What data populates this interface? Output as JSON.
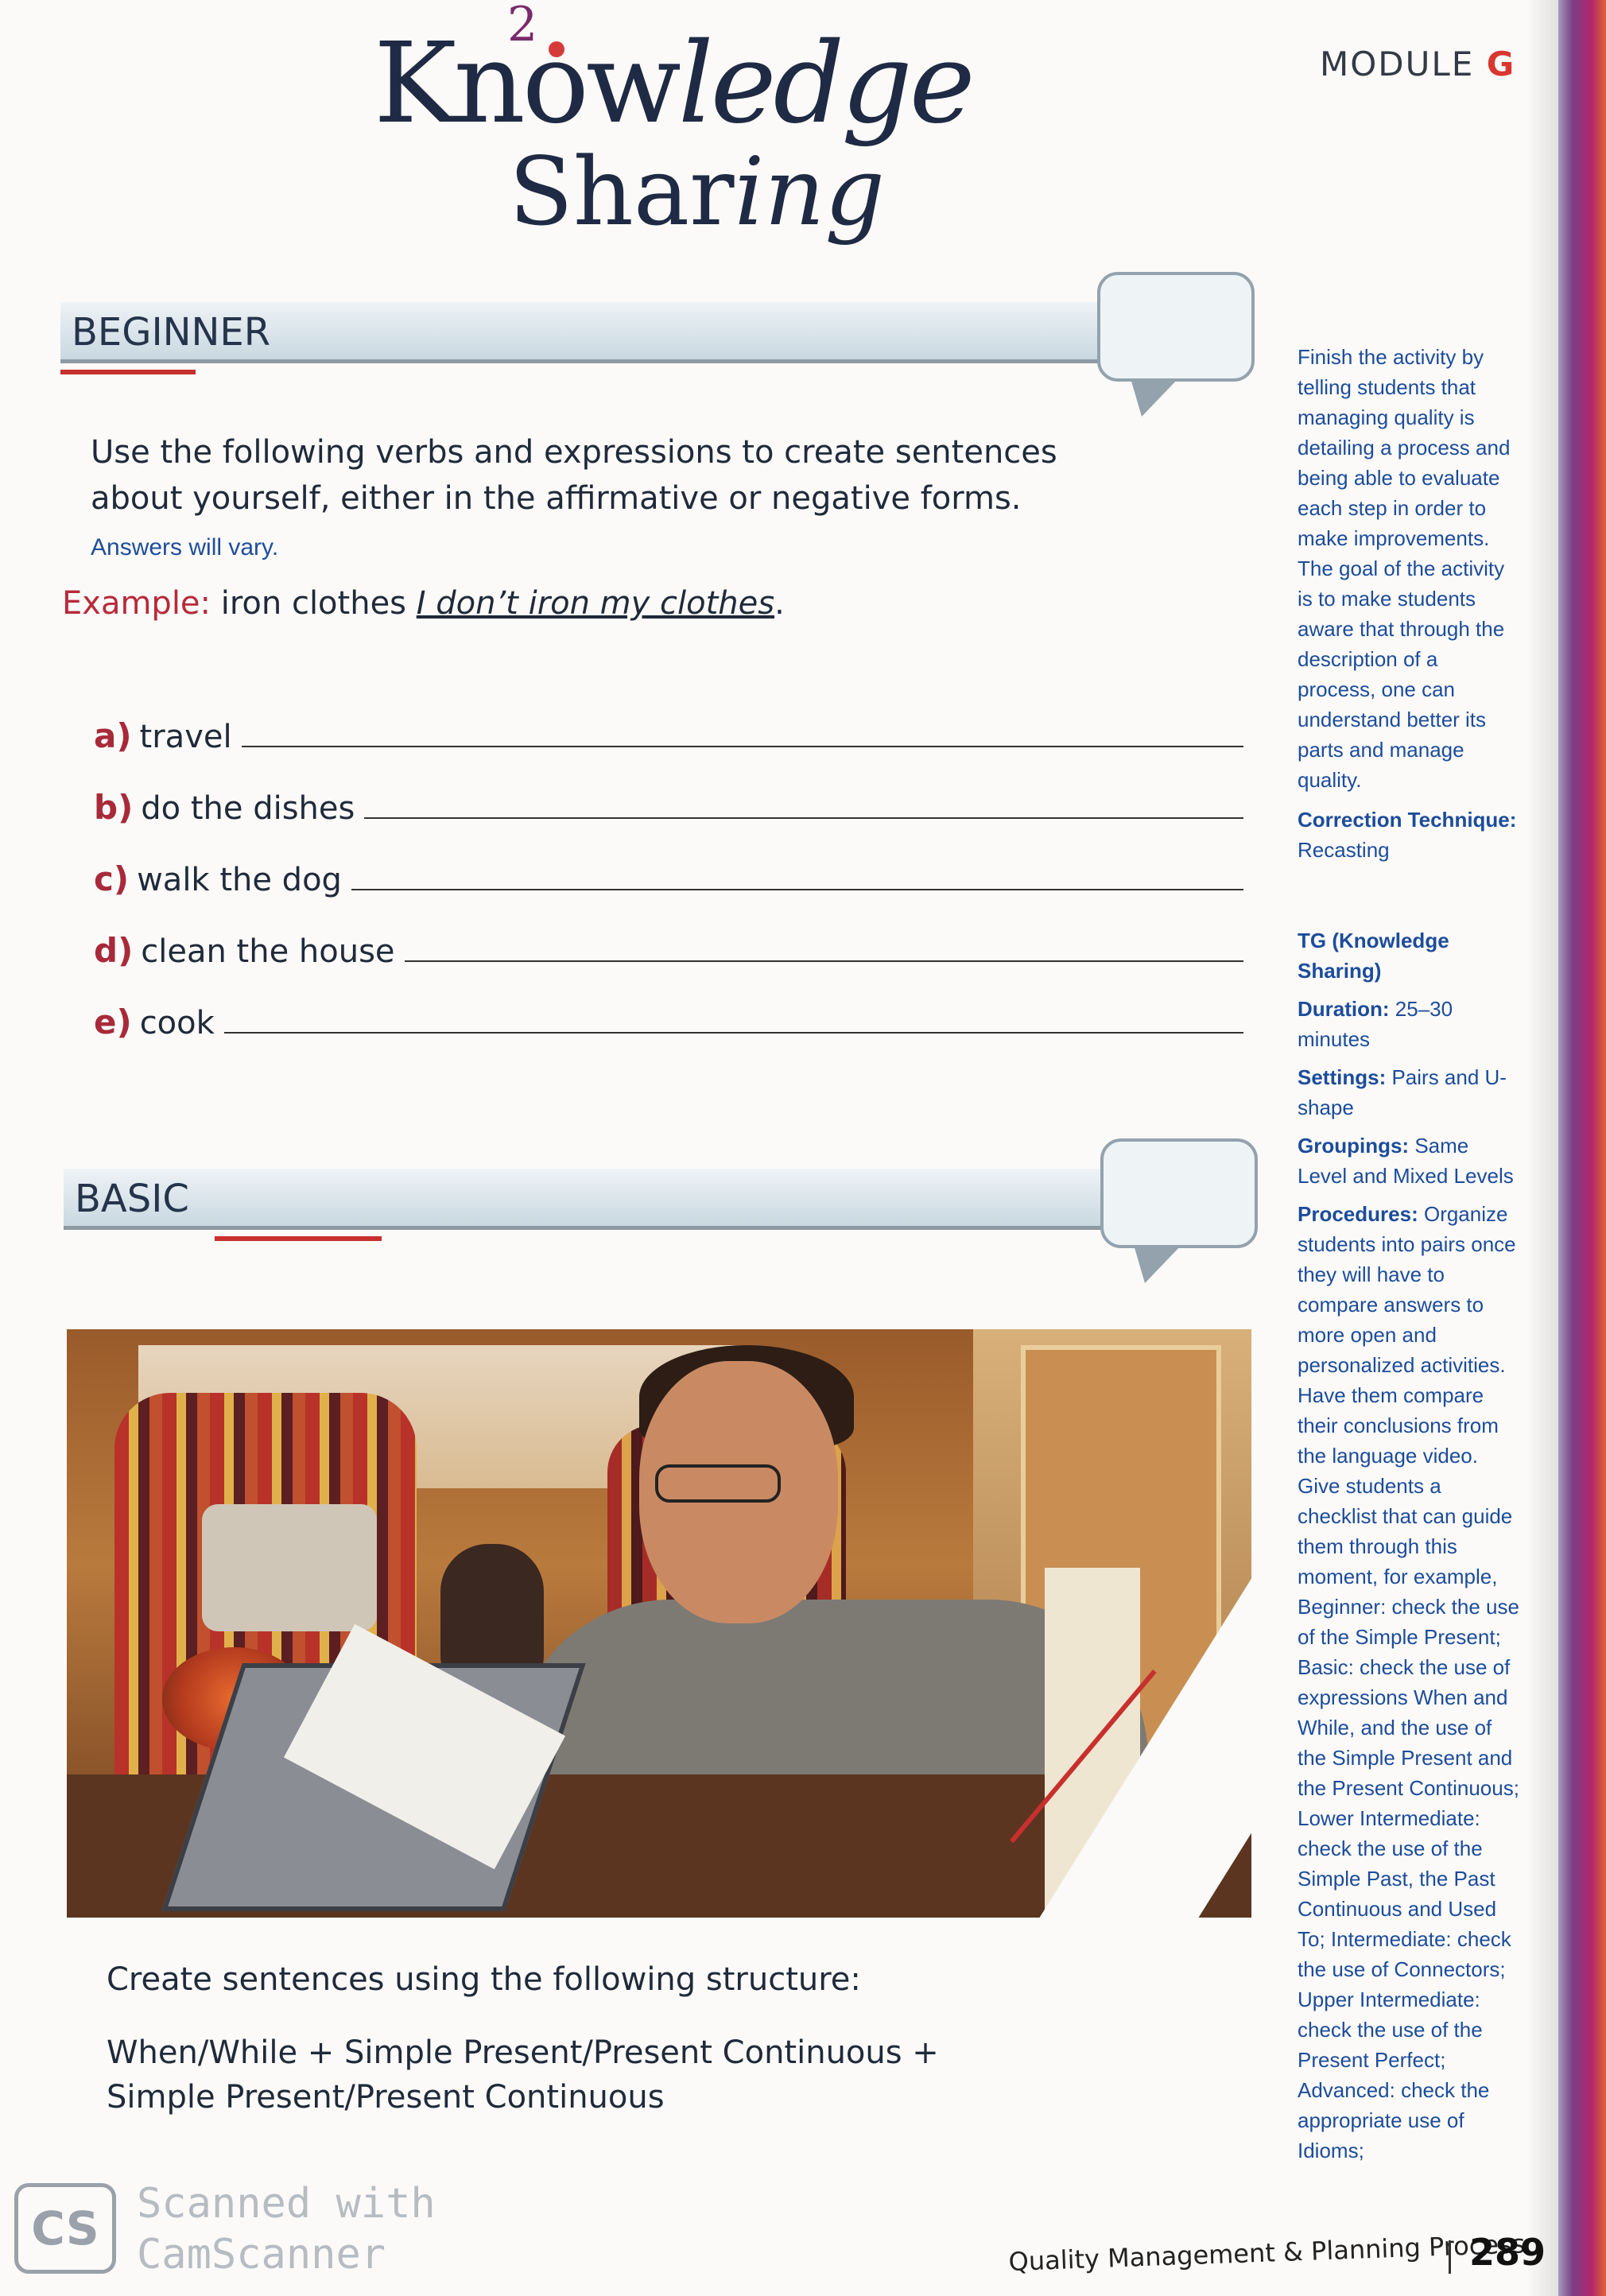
{
  "header": {
    "logo_number": "2",
    "logo_word1_plain": "Know",
    "logo_word1_italic": "ledge",
    "logo_word2_plain": "Shar",
    "logo_word2_italic": "ing",
    "module_label": "MODULE",
    "module_letter": "G"
  },
  "beginner": {
    "title": "BEGINNER",
    "instruction": "Use the following verbs and expressions to create sentences about yourself, either in the affirmative or negative forms.",
    "note": "Answers will vary.",
    "example_label": "Example:",
    "example_prompt": "iron clothes",
    "example_answer": "I don’t iron my clothes",
    "example_end": ".",
    "items": [
      {
        "letter": "a)",
        "text": "travel"
      },
      {
        "letter": "b)",
        "text": "do the dishes"
      },
      {
        "letter": "c)",
        "text": "walk the dog"
      },
      {
        "letter": "d)",
        "text": "clean the house"
      },
      {
        "letter": "e)",
        "text": "cook"
      }
    ]
  },
  "basic": {
    "title": "BASIC",
    "instruction": "Create sentences using the following structure:",
    "structure_line1": "When/While + Simple Present/Present Continuous +",
    "structure_line2": "Simple Present/Present Continuous"
  },
  "sidebar": {
    "intro": "Finish the activity by telling students that managing quality is detailing a process and being able to evaluate each step in order to make improvements. The goal of the activity is to make students aware that through the description of a process, one can understand better its parts and manage quality.",
    "correction_label": "Correction Technique:",
    "correction_value": "Recasting",
    "tg_title": "TG (Knowledge Sharing)",
    "duration_label": "Duration:",
    "duration_value": "25–30 minutes",
    "settings_label": "Settings:",
    "settings_value": "Pairs and U-shape",
    "groupings_label": "Groupings:",
    "groupings_value": "Same Level and Mixed Levels",
    "procedures_label": "Procedures:",
    "procedures_value": "Organize students into pairs once they will have to compare answers to more open and personalized activities. Have them compare their conclusions from the language video. Give students a checklist that can guide them through this moment, for example, Beginner: check the use of the Simple Present; Basic: check the use of expressions When and While, and the use of the Simple Present and the Present Continuous; Lower Intermediate: check the use of the Simple Past, the Past Continuous and Used To; Intermediate: check the use of Connectors; Upper Intermediate: check the use of the Present Perfect; Advanced: check the appropriate use of Idioms;"
  },
  "watermark": {
    "logo": "CS",
    "line1": "Scanned with",
    "line2": "CamScanner"
  },
  "footer": {
    "title": "Quality Management & Planning Process",
    "page": "289"
  },
  "colors": {
    "accent_red": "#c7302d",
    "sidebar_blue": "#1c4c9b",
    "heading_navy": "#1f2a44"
  }
}
